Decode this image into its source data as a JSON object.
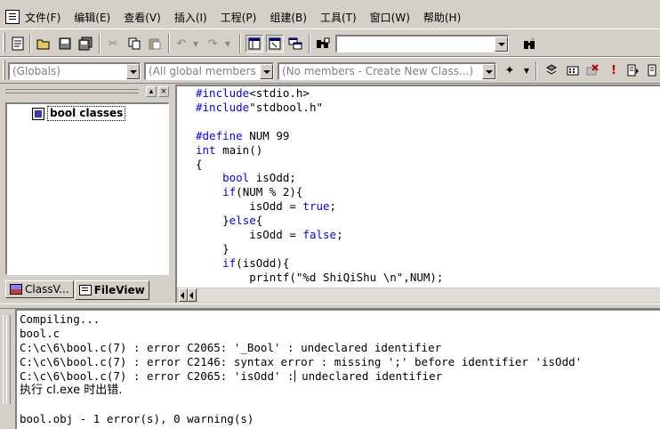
{
  "menu": [
    "文件(F)",
    "编辑(E)",
    "查看(V)",
    "插入(I)",
    "工程(P)",
    "组建(B)",
    "工具(T)",
    "窗口(W)",
    "帮助(H)"
  ],
  "toolbar": {
    "find_combo_value": ""
  },
  "wizard_bar": {
    "class_combo": "(Globals)",
    "filter_combo": "(All global members",
    "members_combo": "(No members - Create New Class...)"
  },
  "workspace": {
    "tree_root": "bool classes",
    "tabs": [
      "ClassV...",
      "FileView"
    ]
  },
  "editor": {
    "lines": [
      "#include<stdio.h>",
      "#include\"stdbool.h\"",
      "",
      "#define NUM 99",
      "int main()",
      "{",
      "    bool isOdd;",
      "    if(NUM % 2){",
      "        isOdd = true;",
      "    }else{",
      "        isOdd = false;",
      "    }",
      "    if(isOdd){",
      "        printf(\"%d ShiQiShu \\n\",NUM);"
    ]
  },
  "output": {
    "lines": [
      "Compiling...",
      "bool.c",
      "C:\\c\\6\\bool.c(7) : error C2065: '_Bool' : undeclared identifier",
      "C:\\c\\6\\bool.c(7) : error C2146: syntax error : missing ';' before identifier 'isOdd'",
      "C:\\c\\6\\bool.c(7) : error C2065: 'isOdd' : undeclared identifier",
      "执行 cl.exe 时出错.",
      "",
      "bool.obj - 1 error(s), 0 warning(s)"
    ]
  },
  "colors": {
    "chrome": "#d4d0c8",
    "keyword": "#0000ff"
  }
}
